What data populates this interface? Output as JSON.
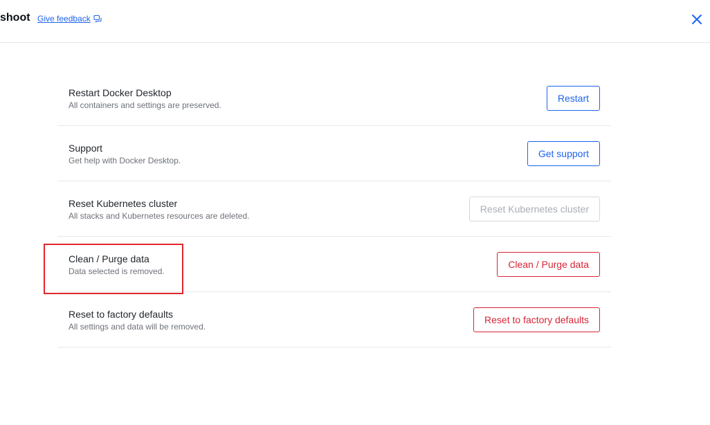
{
  "header": {
    "title": "shoot",
    "feedback_label": "Give feedback",
    "feedback_icon": "feedback-icon",
    "close_icon": "close-icon"
  },
  "rows": [
    {
      "title": "Restart Docker Desktop",
      "description": "All containers and settings are preserved.",
      "button_label": "Restart",
      "button_style": "primary"
    },
    {
      "title": "Support",
      "description": "Get help with Docker Desktop.",
      "button_label": "Get support",
      "button_style": "primary"
    },
    {
      "title": "Reset Kubernetes cluster",
      "description": "All stacks and Kubernetes resources are deleted.",
      "button_label": "Reset Kubernetes cluster",
      "button_style": "disabled"
    },
    {
      "title": "Clean / Purge data",
      "description": "Data selected is removed.",
      "button_label": "Clean / Purge data",
      "button_style": "danger"
    },
    {
      "title": "Reset to factory defaults",
      "description": "All settings and data will be removed.",
      "button_label": "Reset to factory defaults",
      "button_style": "danger"
    }
  ],
  "colors": {
    "primary": "#1d63ed",
    "danger": "#d52536",
    "disabled": "#a9adb3",
    "highlight": "#e0262d"
  }
}
